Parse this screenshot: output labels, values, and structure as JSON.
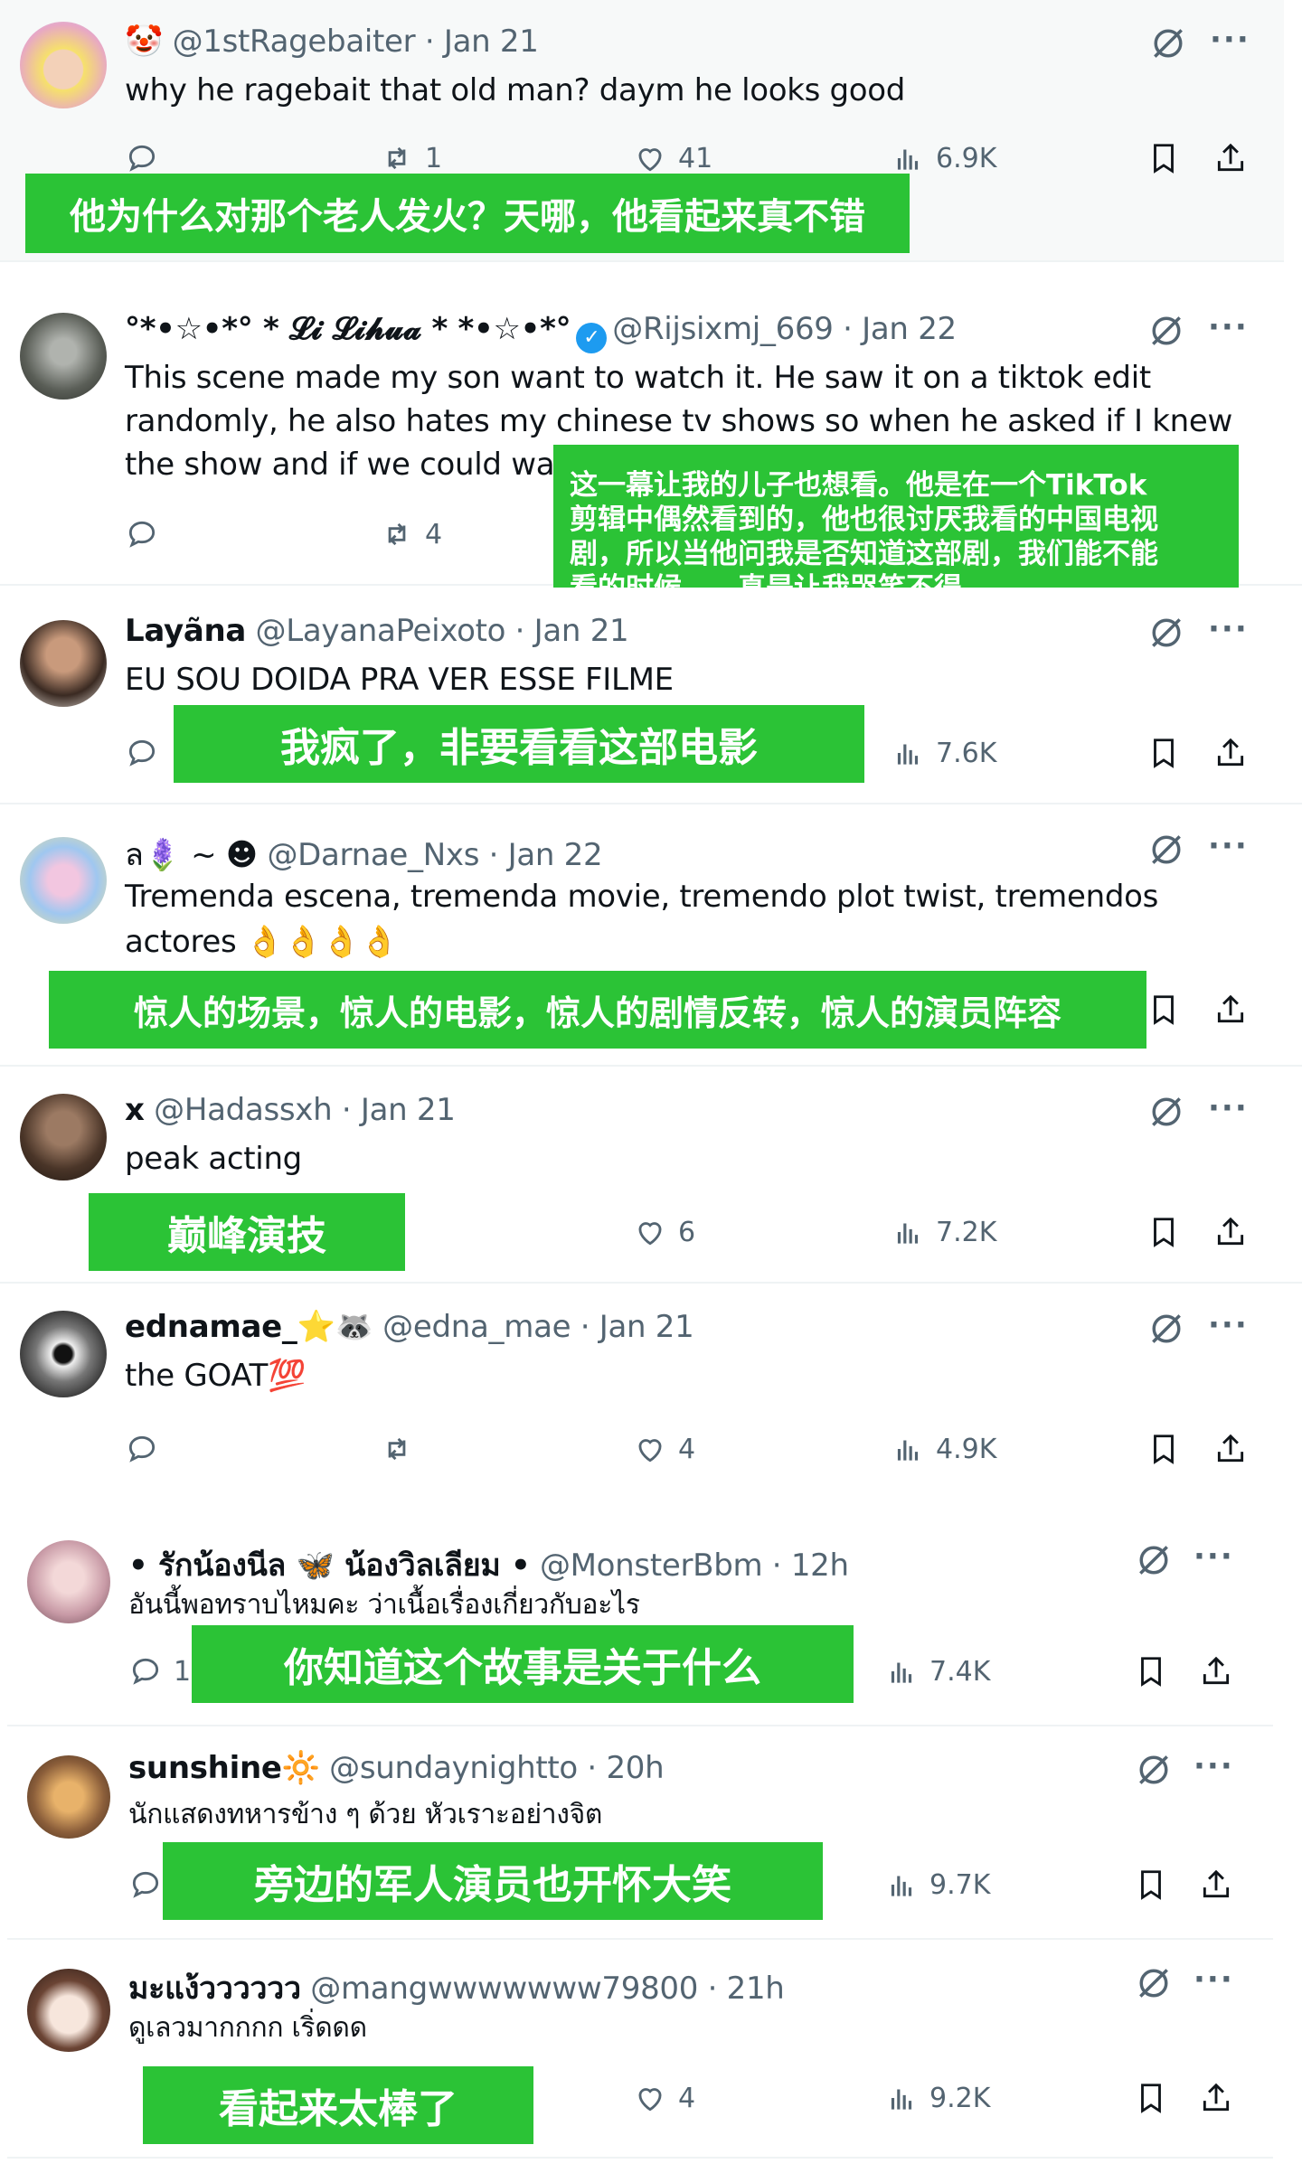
{
  "posts": [
    {
      "name": "",
      "handle": "@1stRagebaiter",
      "date": "Jan 21",
      "text": "why he ragebait that old man? daym he looks good",
      "replies": "",
      "reposts": "1",
      "likes": "41",
      "views": "6.9K",
      "translation": "他为什么对那个老人发火？天哪，他看起来真不错"
    },
    {
      "name": "°*•☆•*° * 𝓛𝓲 𝓛𝓲𝓱𝓾𝓪 * *•☆•*°",
      "handle": "@Rijsixmj_669",
      "date": "Jan 22",
      "text_lines": [
        "This scene made my son want to watch it. He saw it on a tiktok edit",
        "randomly, he also hates my chinese tv shows so when he asked if I knew",
        "the show and if we could wat"
      ],
      "reposts": "4",
      "translation_lines": [
        "这一幕让我的儿子也想看。他是在一个TikTok",
        "剪辑中偶然看到的，他也很讨厌我看的中国电视",
        "剧，所以当他问我是否知道这部剧，我们能不能",
        "看的时候……真是让我哭笑不得"
      ]
    },
    {
      "name": "Layãna",
      "handle": "@LayanaPeixoto",
      "date": "Jan 21",
      "text": "EU SOU DOIDA PRA VER ESSE FILME",
      "views": "7.6K",
      "translation": "我疯了，非要看看这部电影"
    },
    {
      "name": "ล🪻 ~ ☻",
      "handle": "@Darnae_Nxs",
      "date": "Jan 22",
      "text": "Tremenda escena, tremenda movie, tremendo plot twist, tremendos",
      "text2": "actores 👌👌👌👌",
      "translation": "惊人的场景，惊人的电影，惊人的剧情反转，惊人的演员阵容"
    },
    {
      "name": "x",
      "handle": "@Hadassxh",
      "date": "Jan 21",
      "text": "peak acting",
      "likes": "6",
      "views": "7.2K",
      "translation": "巅峰演技"
    },
    {
      "name": "ednamae_",
      "emoji": "⭐🦝",
      "handle": "@edna_mae",
      "date": "Jan 21",
      "text": "the GOAT💯",
      "likes": "4",
      "views": "4.9K"
    },
    {
      "name": "• รักน้องนีล 🦋 น้องวิลเลียม •",
      "handle": "@MonsterBbm",
      "date": "12h",
      "text": "อันนี้พอทราบไหมคะ ว่าเนื้อเรื่องเกี่ยวกับอะไร",
      "replies": "1",
      "views": "7.4K",
      "translation": "你知道这个故事是关于什么"
    },
    {
      "name": "sunshine",
      "emoji": "🔆",
      "handle": "@sundaynightto",
      "date": "20h",
      "text": "นักแสดงทหารข้าง ๆ ด้วย หัวเราะอย่างจิต",
      "views": "9.7K",
      "translation": "旁边的军人演员也开怀大笑"
    },
    {
      "name": "มะแง้วววววว",
      "handle": "@mangwwwwwww79800",
      "date": "21h",
      "text": "ดูเลวมากกกก เริ่ดดด",
      "likes": "4",
      "views": "9.2K",
      "translation": "看起来太棒了"
    }
  ],
  "icons": [
    "clown-emoji",
    "grok-icon",
    "more-icon",
    "reply-icon",
    "repost-icon",
    "like-icon",
    "views-icon",
    "bookmark-icon",
    "share-icon",
    "verified-badge"
  ],
  "colors": {
    "overlay": "#2bc336",
    "secondary_text": "#536471",
    "primary_text": "#0f1419",
    "verified": "#1d9bf0"
  },
  "sep": " · "
}
